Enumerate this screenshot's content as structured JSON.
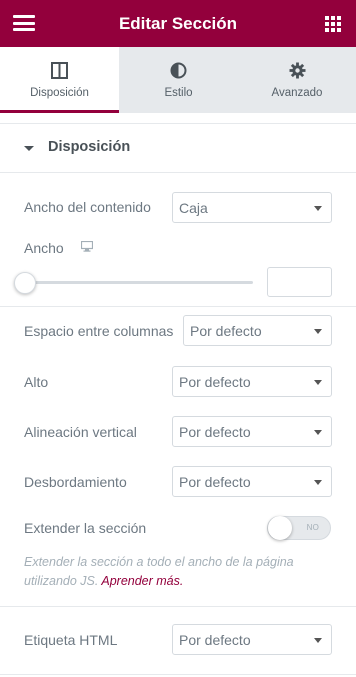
{
  "header": {
    "title": "Editar Sección",
    "menu_icon": "hamburger-menu-icon",
    "widgets_icon": "grid-apps-icon",
    "bg_color": "#93003c"
  },
  "tabs": [
    {
      "label": "Disposición",
      "icon": "columns-layout-icon",
      "active": true
    },
    {
      "label": "Estilo",
      "icon": "half-circle-contrast-icon",
      "active": false
    },
    {
      "label": "Avanzado",
      "icon": "gear-icon",
      "active": false
    }
  ],
  "section": {
    "title": "Disposición",
    "icon": "caret-down-icon"
  },
  "controls": {
    "content_width": {
      "label": "Ancho del contenido",
      "value": "Caja"
    },
    "width": {
      "label": "Ancho",
      "device_icon": "desktop-monitor-icon",
      "slider_value": 0,
      "input_value": ""
    },
    "column_gap": {
      "label": "Espacio entre columnas",
      "value": "Por defecto"
    },
    "height": {
      "label": "Alto",
      "value": "Por defecto"
    },
    "vertical_align": {
      "label": "Alineación vertical",
      "value": "Por defecto"
    },
    "overflow": {
      "label": "Desbordamiento",
      "value": "Por defecto"
    },
    "stretch": {
      "label": "Extender la sección",
      "toggle_label": "NO",
      "enabled": false,
      "description": "Extender la sección a todo el ancho de la página utilizando JS.",
      "link_text": "Aprender más."
    },
    "html_tag": {
      "label": "Etiqueta HTML",
      "value": "Por defecto"
    }
  }
}
